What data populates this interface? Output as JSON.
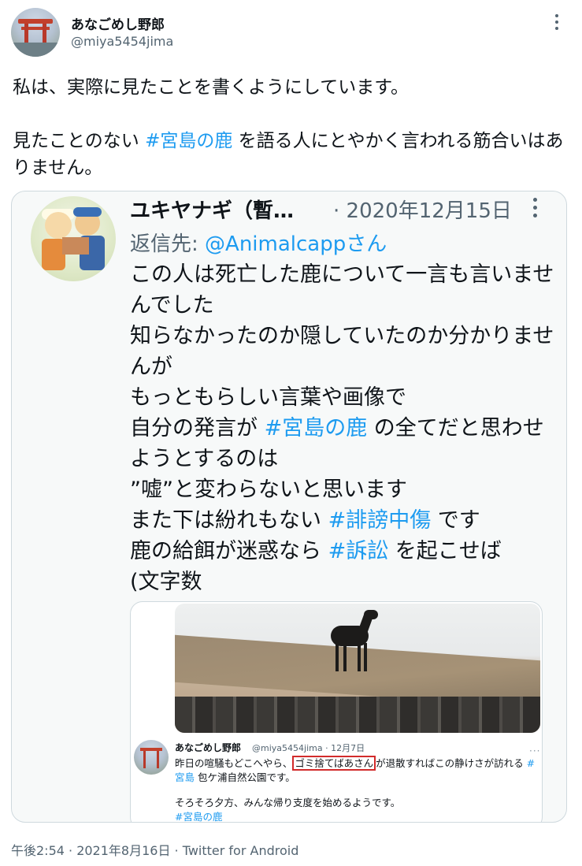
{
  "author": {
    "display_name": "あなごめし野郎",
    "handle": "@miya5454jima"
  },
  "tweet": {
    "line1": "私は、実際に見たことを書くようにしています。",
    "line2_pre": "見たことのない ",
    "line2_tag": "#宮島の鹿",
    "line2_post": " を語る人にとやかく言われる筋合いはありません。"
  },
  "embedded": {
    "name": "ユキヤナギ（暫…",
    "date": "· 2020年12月15日",
    "reply_prefix": "返信先: ",
    "reply_to": "@Animalcappさん",
    "lines": {
      "l1": "この人は死亡した鹿について一言も言いませんでした",
      "l2": "知らなかったのか隠していたのか分かりませんが",
      "l3": "もっともらしい言葉や画像で",
      "l4_pre": "自分の発言が ",
      "l4_tag": "#宮島の鹿",
      "l4_post": " の全てだと思わせようとするのは",
      "l5": "”嘘”と変わらないと思います",
      "l6_pre": "また下は紛れもない ",
      "l6_tag": "#誹謗中傷",
      "l6_post": " です",
      "l7_pre": "鹿の給餌が迷惑なら ",
      "l7_tag": "#訴訟",
      "l7_post": " を起こせば",
      "l8": "(文字数"
    },
    "quoted": {
      "name": "あなごめし野郎",
      "meta": "@miya5454jima · 12月7日",
      "more": "···",
      "text_pre": "昨日の喧騒もどこへやら、",
      "text_box": "ゴミ捨てばあさん",
      "text_post": "が退散すればこの静けさが訪れる ",
      "tag1": "#宮島",
      "text_end": " 包ケ浦自然公園です。",
      "text2": "そろそろ夕方、みんな帰り支度を始めるようです。",
      "tag2": "#宮島の鹿"
    }
  },
  "footer": {
    "meta": "午後2:54 · 2021年8月16日 · Twitter for Android"
  },
  "colors": {
    "link": "#1d9bf0",
    "secondary_text": "#536471",
    "highlight_box": "#d22b2b"
  }
}
